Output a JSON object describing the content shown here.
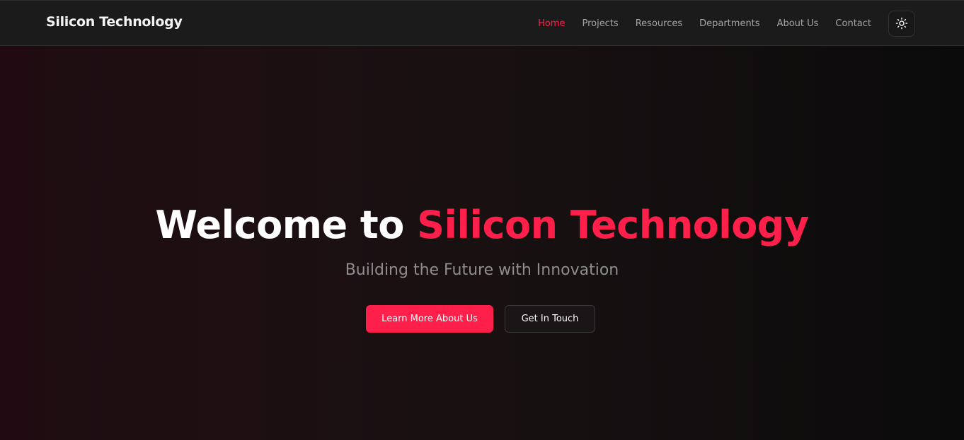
{
  "navbar": {
    "brand": "Silicon Technology",
    "links": [
      {
        "label": "Home",
        "active": true
      },
      {
        "label": "Projects",
        "active": false
      },
      {
        "label": "Resources",
        "active": false
      },
      {
        "label": "Departments",
        "active": false
      },
      {
        "label": "About Us",
        "active": false
      },
      {
        "label": "Contact",
        "active": false
      }
    ],
    "theme_toggle_icon": "sun-icon"
  },
  "hero": {
    "title_prefix": "Welcome to",
    "title_highlight": "Silicon Technology",
    "subtitle": "Building the Future with Innovation",
    "primary_button": "Learn More About Us",
    "secondary_button": "Get In Touch"
  },
  "colors": {
    "accent": "#ff1f4b",
    "nav_background": "#1b1b1b",
    "page_background": "#0b0b0b"
  }
}
